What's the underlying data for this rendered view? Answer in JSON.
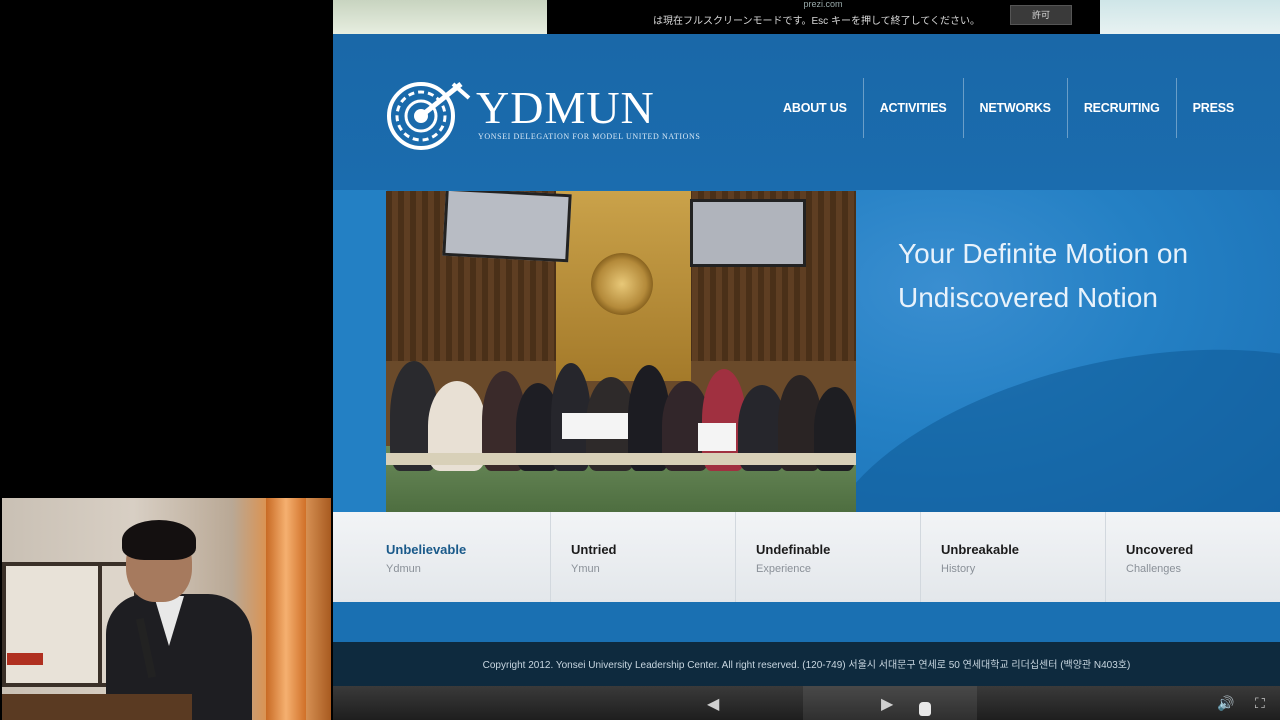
{
  "fullscreen_notice": {
    "domain": "prezi.com",
    "message": "は現在フルスクリーンモードです。Esc キーを押して終了してください。",
    "allow_label": "許可"
  },
  "site": {
    "logo": {
      "title": "YDMUN",
      "subtitle": "YONSEI DELEGATION FOR MODEL UNITED NATIONS"
    },
    "nav": [
      "ABOUT US",
      "ACTIVITIES",
      "NETWORKS",
      "RECRUITING",
      "PRESS"
    ],
    "tagline_line1": "Your Definite Motion on",
    "tagline_line2": "Undiscovered Notion",
    "features": [
      {
        "title": "Unbelievable",
        "sub": "Ydmun"
      },
      {
        "title": "Untried",
        "sub": "Ymun"
      },
      {
        "title": "Undefinable",
        "sub": "Experience"
      },
      {
        "title": "Unbreakable",
        "sub": "History"
      },
      {
        "title": "Uncovered",
        "sub": "Challenges"
      }
    ],
    "footer": "Copyright 2012. Yonsei University Leadership Center. All right reserved. (120-749) 서울시 서대문구 연세로 50 연세대학교 리더십센터 (백양관 N403호)"
  },
  "player": {
    "prev_icon": "◀",
    "next_icon": "▶",
    "sound_icon": "🔊",
    "fullscreen_icon": "⛶"
  },
  "colors": {
    "header_blue": "#1a68a8",
    "hero_blue": "#2480c4",
    "footer_dark": "#0e2a3e",
    "active_feature": "#1a5a8a"
  }
}
